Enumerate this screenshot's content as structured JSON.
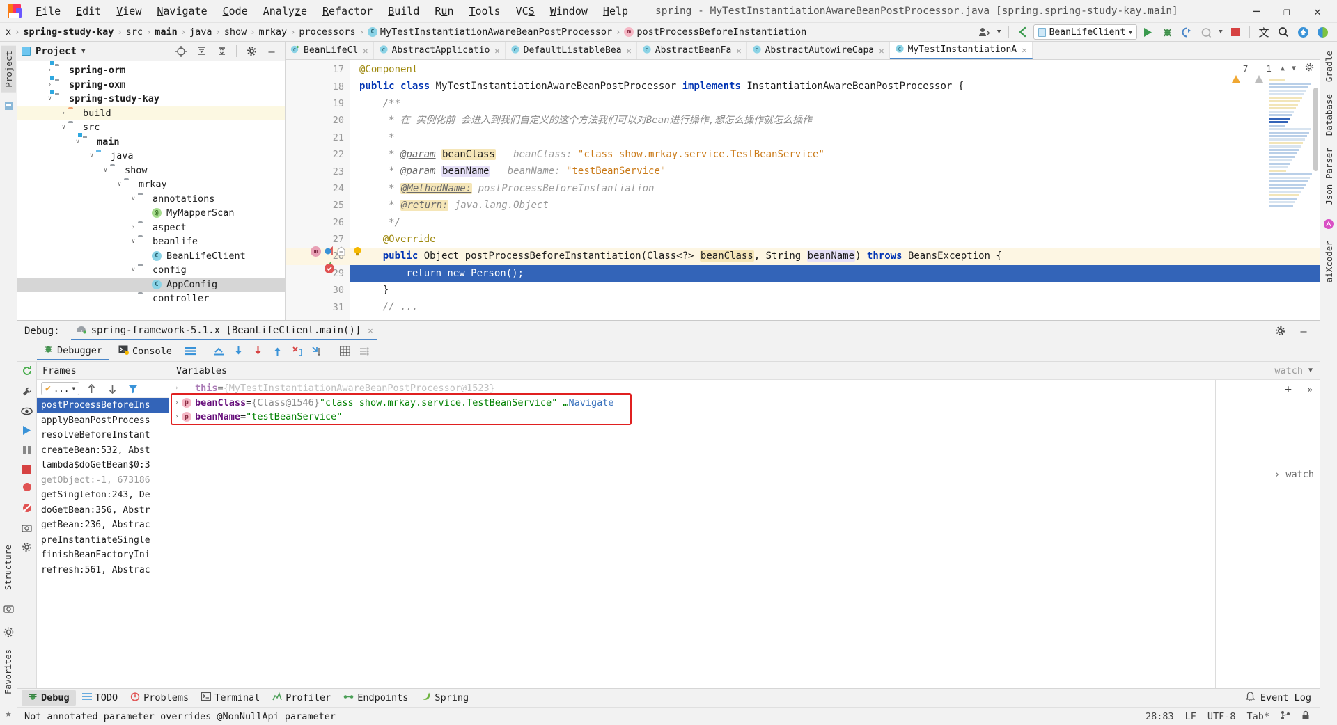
{
  "window": {
    "title": "spring - MyTestInstantiationAwareBeanPostProcessor.java [spring.spring-study-kay.main]",
    "minimize": "─",
    "maximize": "❐",
    "close": "✕"
  },
  "menu": [
    "File",
    "Edit",
    "View",
    "Navigate",
    "Code",
    "Analyze",
    "Refactor",
    "Build",
    "Run",
    "Tools",
    "VCS",
    "Window",
    "Help"
  ],
  "breadcrumb": {
    "prefix": "x",
    "items": [
      {
        "label": "spring-study-kay",
        "bold": true,
        "icon": ""
      },
      {
        "label": "src",
        "bold": false,
        "icon": ""
      },
      {
        "label": "main",
        "bold": true,
        "icon": ""
      },
      {
        "label": "java",
        "bold": false,
        "icon": ""
      },
      {
        "label": "show",
        "bold": false,
        "icon": ""
      },
      {
        "label": "mrkay",
        "bold": false,
        "icon": ""
      },
      {
        "label": "processors",
        "bold": false,
        "icon": ""
      },
      {
        "label": "MyTestInstantiationAwareBeanPostProcessor",
        "bold": false,
        "icon": "class-icon"
      },
      {
        "label": "postProcessBeforeInstantiation",
        "bold": false,
        "icon": "method-icon"
      }
    ]
  },
  "toolbar": {
    "run_config": "BeanLifeClient",
    "run_tooltip": "Run",
    "debug_tooltip": "Debug",
    "coverage_tooltip": "Run with Coverage",
    "profile_tooltip": "Profile",
    "stop_tooltip": "Stop",
    "translate_tooltip": "Translate",
    "search_tooltip": "Search Everywhere",
    "update_tooltip": "Update Project",
    "ai_tooltip": "AI Assistant"
  },
  "left_strip": {
    "tabs": [
      "Project"
    ],
    "icons": [
      "structure-icon"
    ]
  },
  "right_strip": {
    "tabs": [
      "Gradle",
      "Database",
      "Json Parser",
      "aiXcoder"
    ]
  },
  "project_panel": {
    "title": "Project",
    "actions": [
      "locate-icon",
      "expand-all-icon",
      "collapse-all-icon",
      "settings-icon",
      "hide-icon"
    ],
    "tree": [
      {
        "label": "spring-orm",
        "indent": 1,
        "arrow": "›",
        "icon": "module-folder",
        "bold": true,
        "state": "normal"
      },
      {
        "label": "spring-oxm",
        "indent": 1,
        "arrow": "›",
        "icon": "module-folder",
        "bold": true,
        "state": "normal"
      },
      {
        "label": "spring-study-kay",
        "indent": 1,
        "arrow": "∨",
        "icon": "module-folder",
        "bold": true,
        "state": "normal"
      },
      {
        "label": "build",
        "indent": 2,
        "arrow": "›",
        "icon": "orange-folder",
        "bold": false,
        "state": "highlight"
      },
      {
        "label": "src",
        "indent": 2,
        "arrow": "∨",
        "icon": "gray-folder",
        "bold": false,
        "state": "normal"
      },
      {
        "label": "main",
        "indent": 3,
        "arrow": "∨",
        "icon": "module-folder",
        "bold": true,
        "state": "normal"
      },
      {
        "label": "java",
        "indent": 4,
        "arrow": "∨",
        "icon": "blue-folder",
        "bold": false,
        "state": "normal"
      },
      {
        "label": "show",
        "indent": 5,
        "arrow": "∨",
        "icon": "package-folder",
        "bold": false,
        "state": "normal"
      },
      {
        "label": "mrkay",
        "indent": 6,
        "arrow": "∨",
        "icon": "package-folder",
        "bold": false,
        "state": "normal"
      },
      {
        "label": "annotations",
        "indent": 7,
        "arrow": "∨",
        "icon": "package-folder",
        "bold": false,
        "state": "normal"
      },
      {
        "label": "MyMapperScan",
        "indent": 8,
        "arrow": "",
        "icon": "annotation-icon",
        "bold": false,
        "state": "normal"
      },
      {
        "label": "aspect",
        "indent": 7,
        "arrow": "›",
        "icon": "package-folder",
        "bold": false,
        "state": "normal"
      },
      {
        "label": "beanlife",
        "indent": 7,
        "arrow": "∨",
        "icon": "package-folder",
        "bold": false,
        "state": "normal"
      },
      {
        "label": "BeanLifeClient",
        "indent": 8,
        "arrow": "",
        "icon": "class-icon",
        "bold": false,
        "state": "normal"
      },
      {
        "label": "config",
        "indent": 7,
        "arrow": "∨",
        "icon": "package-folder",
        "bold": false,
        "state": "normal"
      },
      {
        "label": "AppConfig",
        "indent": 8,
        "arrow": "",
        "icon": "class-icon",
        "bold": false,
        "state": "selected"
      },
      {
        "label": "controller",
        "indent": 7,
        "arrow": "",
        "icon": "package-folder",
        "bold": false,
        "state": "normal"
      }
    ]
  },
  "editor": {
    "tabs": [
      {
        "label": "BeanLifeCl",
        "icon": "class-run-icon",
        "active": false
      },
      {
        "label": "AbstractApplicatio",
        "icon": "class-icon",
        "active": false
      },
      {
        "label": "DefaultListableBea",
        "icon": "class-icon",
        "active": false
      },
      {
        "label": "AbstractBeanFa",
        "icon": "class-icon",
        "active": false
      },
      {
        "label": "AbstractAutowireCapable",
        "icon": "class-icon",
        "active": false
      },
      {
        "label": "MyTestInstantiationAwareBeanP",
        "icon": "class-icon",
        "active": true
      }
    ],
    "warnings": {
      "warn_count": "7",
      "weak_count": "1",
      "warn_icon": "warning-triangle-icon",
      "weak_icon": "weak-warning-icon"
    },
    "line_numbers": [
      "17",
      "18",
      "19",
      "20",
      "21",
      "22",
      "23",
      "24",
      "25",
      "26",
      "27",
      "28",
      "29",
      "30",
      "31"
    ],
    "current_line": "28",
    "lines": [
      {
        "n": "17",
        "tokens": [
          {
            "t": "@Component",
            "c": "anno"
          }
        ]
      },
      {
        "n": "18",
        "tokens": [
          {
            "t": "public ",
            "c": "kw"
          },
          {
            "t": "class ",
            "c": "kw"
          },
          {
            "t": "MyTestInstantiationAwareBeanPostProcessor ",
            "c": "typ"
          },
          {
            "t": "implements ",
            "c": "kw"
          },
          {
            "t": "InstantiationAwareBeanPostProcessor {",
            "c": "typ"
          }
        ]
      },
      {
        "n": "19",
        "tokens": [
          {
            "t": "    /**",
            "c": "cmt"
          }
        ]
      },
      {
        "n": "20",
        "tokens": [
          {
            "t": "     * 在 实例化前 会进入到我们自定义的这个方法我们可以对Bean进行操作,想怎么操作就怎么操作",
            "c": "cmt"
          }
        ]
      },
      {
        "n": "21",
        "tokens": [
          {
            "t": "     *",
            "c": "cmt"
          }
        ]
      },
      {
        "n": "22",
        "tokens": [
          {
            "t": "     * ",
            "c": "cmt"
          },
          {
            "t": "@param",
            "c": "ulink"
          },
          {
            "t": " ",
            "c": "cmt"
          },
          {
            "t": "beanClass",
            "c": "hintbg"
          },
          {
            "t": "   beanClass: ",
            "c": "hint"
          },
          {
            "t": "\"class show.mrkay.service.TestBeanService\"",
            "c": "str"
          }
        ]
      },
      {
        "n": "23",
        "tokens": [
          {
            "t": "     * ",
            "c": "cmt"
          },
          {
            "t": "@param",
            "c": "ulink"
          },
          {
            "t": " ",
            "c": "cmt"
          },
          {
            "t": "beanName",
            "c": "hintbg2"
          },
          {
            "t": "   beanName: ",
            "c": "hint"
          },
          {
            "t": "\"testBeanService\"",
            "c": "str"
          }
        ]
      },
      {
        "n": "24",
        "tokens": [
          {
            "t": "     * ",
            "c": "cmt"
          },
          {
            "t": "@MethodName:",
            "c": "hintbg-ul"
          },
          {
            "t": " postProcessBeforeInstantiation",
            "c": "hint"
          }
        ]
      },
      {
        "n": "25",
        "tokens": [
          {
            "t": "     * ",
            "c": "cmt"
          },
          {
            "t": "@return:",
            "c": "hintbg-ul"
          },
          {
            "t": " java.lang.Object",
            "c": "hint"
          }
        ]
      },
      {
        "n": "26",
        "tokens": [
          {
            "t": "     */",
            "c": "cmt"
          }
        ]
      },
      {
        "n": "27",
        "tokens": [
          {
            "t": "    @Override",
            "c": "anno"
          }
        ]
      },
      {
        "n": "28",
        "tokens": [
          {
            "t": "    public ",
            "c": "kw"
          },
          {
            "t": "Object ",
            "c": "typ"
          },
          {
            "t": "postProcessBeforeInstantiation",
            "c": "typ"
          },
          {
            "t": "(Class<?> ",
            "c": "typ"
          },
          {
            "t": "beanClass",
            "c": "hintbg"
          },
          {
            "t": ", String ",
            "c": "typ"
          },
          {
            "t": "beanName",
            "c": "hintbg2"
          },
          {
            "t": ") ",
            "c": "typ"
          },
          {
            "t": "throws ",
            "c": "kw"
          },
          {
            "t": "BeansException {",
            "c": "typ"
          }
        ]
      },
      {
        "n": "29",
        "tokens": [
          {
            "t": "        return new Person();",
            "c": "sel"
          }
        ]
      },
      {
        "n": "30",
        "tokens": [
          {
            "t": "    }",
            "c": "typ"
          }
        ]
      },
      {
        "n": "31",
        "tokens": [
          {
            "t": "    // ...",
            "c": "cmt"
          }
        ]
      }
    ]
  },
  "debug": {
    "header_label": "Debug:",
    "session": "spring-framework-5.1.x [BeanLifeClient.main()]",
    "close_session": "✕",
    "settings_icon": "gear-icon",
    "hide_icon": "minimize-icon",
    "tabs": [
      {
        "label": "Debugger",
        "icon": "debugger-icon",
        "active": true
      },
      {
        "label": "Console",
        "icon": "console-icon",
        "active": false
      }
    ],
    "step_buttons": [
      "show-execution-point",
      "step-over",
      "step-into",
      "force-step-into",
      "step-out",
      "drop-frame",
      "run-to-cursor",
      "evaluate-expression",
      "settings-mute"
    ],
    "frames": {
      "title": "Frames",
      "thread_selector": "...",
      "items": [
        {
          "label": "postProcessBeforeIns",
          "selected": true,
          "dim": false
        },
        {
          "label": "applyBeanPostProcess",
          "selected": false,
          "dim": false
        },
        {
          "label": "resolveBeforeInstant",
          "selected": false,
          "dim": false
        },
        {
          "label": "createBean:532, Abst",
          "selected": false,
          "dim": false
        },
        {
          "label": "lambda$doGetBean$0:3",
          "selected": false,
          "dim": false
        },
        {
          "label": "getObject:-1, 673186",
          "selected": false,
          "dim": true
        },
        {
          "label": "getSingleton:243, De",
          "selected": false,
          "dim": false
        },
        {
          "label": "doGetBean:356, Abstr",
          "selected": false,
          "dim": false
        },
        {
          "label": "getBean:236, Abstrac",
          "selected": false,
          "dim": false
        },
        {
          "label": "preInstantiateSingle",
          "selected": false,
          "dim": false
        },
        {
          "label": "finishBeanFactoryIni",
          "selected": false,
          "dim": false
        },
        {
          "label": "refresh:561, Abstrac",
          "selected": false,
          "dim": false
        }
      ]
    },
    "variables": {
      "title": "Variables",
      "watch_label": "watch",
      "add_icon": "+",
      "more_icon": "»",
      "rows": [
        {
          "arrow": "›",
          "badge": "",
          "name": "this",
          "eq": " = ",
          "value": "{MyTestInstantiationAwareBeanPostProcessor@1523}",
          "value_class": "vdim",
          "extra": "",
          "nav": "",
          "faded": true
        },
        {
          "arrow": "›",
          "badge": "p",
          "name": "beanClass",
          "eq": " = ",
          "value": "{Class@1546} ",
          "value_class": "vdim",
          "extra": "\"class show.mrkay.service.TestBeanService\" … ",
          "nav": "Navigate",
          "faded": false
        },
        {
          "arrow": "›",
          "badge": "p",
          "name": "beanName",
          "eq": " = ",
          "value": "",
          "value_class": "vdim",
          "extra": "\"testBeanService\"",
          "nav": "",
          "faded": false
        }
      ]
    }
  },
  "statusbar": {
    "tools": [
      {
        "label": "Debug",
        "icon": "debug-icon",
        "active": true
      },
      {
        "label": "TODO",
        "icon": "todo-icon",
        "active": false
      },
      {
        "label": "Problems",
        "icon": "problems-icon",
        "active": false
      },
      {
        "label": "Terminal",
        "icon": "terminal-icon",
        "active": false
      },
      {
        "label": "Profiler",
        "icon": "profiler-icon",
        "active": false
      },
      {
        "label": "Endpoints",
        "icon": "endpoints-icon",
        "active": false
      },
      {
        "label": "Spring",
        "icon": "spring-icon",
        "active": false
      }
    ],
    "event_log": "Event Log",
    "event_log_icon": "bell-icon",
    "message": "Not annotated parameter overrides @NonNullApi parameter",
    "position": "28:83",
    "line_sep": "LF",
    "encoding": "UTF-8",
    "indent": "Tab*",
    "lock_icon": "lock-icon",
    "branch_icon": "branch-icon"
  },
  "colors": {
    "accent": "#4a86c8",
    "selection": "#3364b8",
    "keyword": "#0033b3",
    "string": "#ca7a18",
    "annotation": "#9e880d",
    "comment": "#8c8c8c",
    "redbox": "#e02020"
  }
}
